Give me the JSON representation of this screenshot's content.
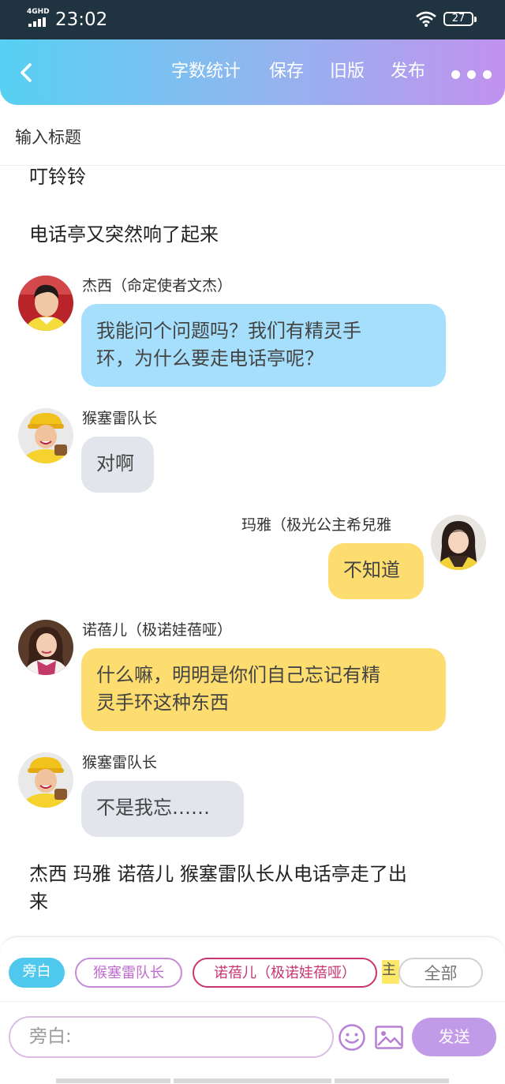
{
  "status_bar": {
    "network": "4GHD",
    "time": "23:02",
    "battery": "27"
  },
  "header": {
    "back_icon": "chevron-left-icon",
    "buttons": [
      "字数统计",
      "保存",
      "旧版",
      "发布"
    ],
    "more_icon": "more-dots-icon"
  },
  "title_placeholder": "输入标题",
  "story": {
    "narration_top_1": "叮铃铃",
    "narration_top_2": "电话亭又突然响了起来",
    "messages": [
      {
        "speaker": "杰西（命定使者文杰）",
        "text_line1": "我能问个问题吗？我们有精灵手",
        "text_line2": "环，为什么要走电话亭呢？",
        "color": "#a6dffc"
      },
      {
        "speaker": "猴塞雷队长",
        "text": "对啊",
        "color": "#e2e6ec"
      },
      {
        "speaker": "玛雅（极光公主希兒雅",
        "text": "不知道",
        "color": "#fddd6f"
      },
      {
        "speaker": "诺蓓儿（极诺娃蓓哑）",
        "text_line1": "什么嘛，明明是你们自己忘记有精",
        "text_line2": "灵手环这种东西",
        "color": "#fddd6f"
      },
      {
        "speaker": "猴塞雷队长",
        "text": "不是我忘……",
        "color": "#e2e6ec"
      }
    ],
    "narration_bottom_line1": "杰西 玛雅 诺蓓儿 猴塞雷队长从电话亭走了出",
    "narration_bottom_line2": "来"
  },
  "role_bar": {
    "chips": [
      "旁白",
      "猴塞雷队长",
      "诺蓓儿（极诺娃蓓哑）"
    ],
    "partial_chip": "主",
    "all_button": "全部"
  },
  "composer": {
    "placeholder": "旁白:",
    "emoji_icon": "smiley-icon",
    "image_icon": "image-icon",
    "send_label": "发送"
  },
  "colors": {
    "accent_cyan": "#4fc8ee",
    "accent_purple": "#c29be8"
  }
}
